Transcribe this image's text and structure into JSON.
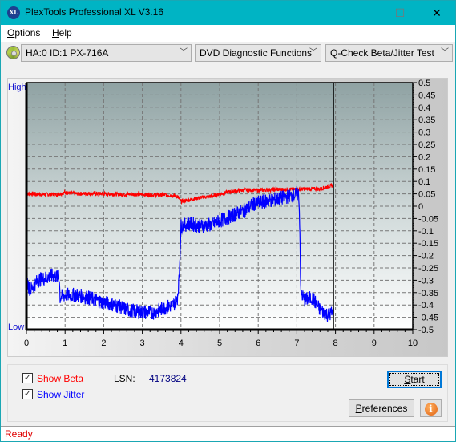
{
  "window": {
    "title": "PlexTools Professional XL V3.16",
    "app_icon_text": "XL",
    "minimize_icon": "—",
    "maximize_icon": "☐",
    "close_icon": "✕"
  },
  "menu": {
    "items": [
      {
        "label": "Options",
        "accel": "O",
        "rest": "ptions"
      },
      {
        "label": "Help",
        "accel": "H",
        "rest": "elp"
      }
    ]
  },
  "toolbar": {
    "drive_select": "HA:0 ID:1  PX-716A",
    "function_select": "DVD Diagnostic Functions",
    "test_select": "Q-Check Beta/Jitter Test",
    "chevron": "﹀"
  },
  "chart_labels": {
    "high": "High",
    "low": "Low"
  },
  "chart_data": {
    "type": "line",
    "title": "Q-Check Beta/Jitter Test",
    "xlabel": "",
    "ylabel": "",
    "xlim": [
      0,
      10
    ],
    "ylim": [
      -0.5,
      0.5
    ],
    "x_ticks": [
      "0",
      "1",
      "2",
      "3",
      "4",
      "5",
      "6",
      "7",
      "8",
      "9",
      "10"
    ],
    "y_ticks": [
      "0.5",
      "0.45",
      "0.4",
      "0.35",
      "0.3",
      "0.25",
      "0.2",
      "0.15",
      "0.1",
      "0.05",
      "0",
      "-0.05",
      "-0.1",
      "-0.15",
      "-0.2",
      "-0.25",
      "-0.3",
      "-0.35",
      "-0.4",
      "-0.45",
      "-0.5"
    ],
    "grid": true,
    "cursor_x": 7.95,
    "series": [
      {
        "name": "Beta",
        "color": "#ff0000",
        "x": [
          0,
          0.2,
          0.5,
          0.8,
          1.0,
          1.3,
          1.6,
          2.0,
          2.5,
          3.0,
          3.4,
          3.7,
          3.9,
          4.0,
          4.2,
          4.5,
          4.8,
          5.0,
          5.3,
          5.6,
          6.0,
          6.5,
          7.0,
          7.3,
          7.6,
          7.95
        ],
        "values": [
          0.05,
          0.05,
          0.048,
          0.048,
          0.055,
          0.05,
          0.052,
          0.05,
          0.048,
          0.048,
          0.046,
          0.045,
          0.04,
          0.02,
          0.025,
          0.035,
          0.04,
          0.05,
          0.06,
          0.065,
          0.065,
          0.068,
          0.068,
          0.07,
          0.07,
          0.085
        ]
      },
      {
        "name": "Jitter",
        "color": "#0000ff",
        "x": [
          0,
          0.1,
          0.3,
          0.5,
          0.7,
          0.85,
          0.87,
          1.0,
          1.3,
          1.6,
          2.0,
          2.3,
          2.6,
          3.0,
          3.3,
          3.6,
          3.8,
          3.9,
          3.95,
          4.0,
          4.2,
          4.5,
          4.8,
          5.0,
          5.3,
          5.6,
          5.9,
          6.2,
          6.5,
          6.8,
          7.05,
          7.08,
          7.1,
          7.2,
          7.4,
          7.6,
          7.8,
          7.95
        ],
        "values": [
          -0.3,
          -0.34,
          -0.3,
          -0.29,
          -0.28,
          -0.29,
          -0.37,
          -0.36,
          -0.36,
          -0.37,
          -0.39,
          -0.4,
          -0.42,
          -0.43,
          -0.43,
          -0.41,
          -0.4,
          -0.38,
          -0.3,
          -0.08,
          -0.07,
          -0.08,
          -0.075,
          -0.06,
          -0.04,
          -0.02,
          0.01,
          0.02,
          0.03,
          0.04,
          0.05,
          -0.1,
          -0.35,
          -0.38,
          -0.37,
          -0.42,
          -0.44,
          -0.43
        ]
      }
    ]
  },
  "controls": {
    "show_beta": {
      "label": "Show Beta",
      "pre": "Show ",
      "accel": "B",
      "rest": "eta",
      "checked": true,
      "color": "#ff0000"
    },
    "show_jitter": {
      "label": "Show Jitter",
      "pre": "Show ",
      "accel": "J",
      "rest": "itter",
      "checked": true,
      "color": "#0000ff"
    },
    "lsn_label": "LSN:",
    "lsn_value": "4173824",
    "start_button": {
      "accel": "S",
      "rest": "tart"
    },
    "preferences_button": {
      "accel": "P",
      "rest": "references"
    },
    "info_icon": "i",
    "check_glyph": "✓"
  },
  "status": {
    "text": "Ready"
  }
}
